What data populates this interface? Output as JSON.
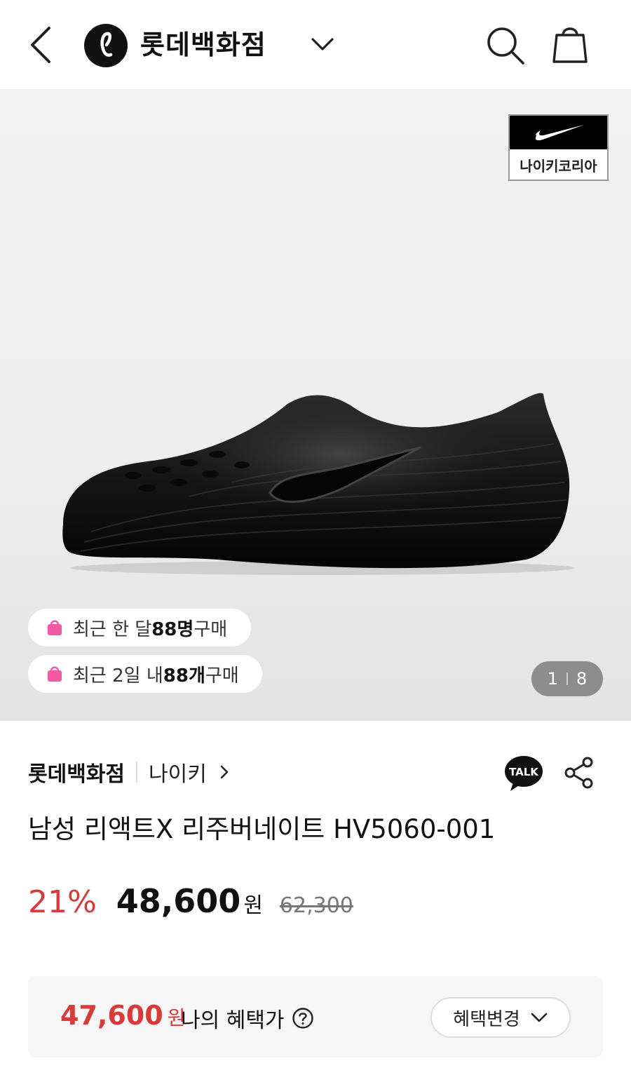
{
  "header": {
    "store_name": "롯데백화점",
    "logo_letter": "ℓ"
  },
  "hero": {
    "brand_badge_label": "나이키코리아",
    "chip1": {
      "prefix": "최근 한 달 ",
      "count": "88명",
      "suffix": " 구매"
    },
    "chip2": {
      "prefix": "최근 2일 내 ",
      "count": "88개",
      "suffix": " 구매"
    },
    "pager": {
      "current": "1",
      "total": "8"
    }
  },
  "product": {
    "seller": "롯데백화점",
    "brand": "나이키",
    "talk_label": "TALK",
    "title": "남성 리액트X 리주버네이트 HV5060-001",
    "discount": "21%",
    "price": "48,600",
    "currency": "원",
    "original_price": "62,300"
  },
  "benefit": {
    "price": "47,600",
    "currency": "원",
    "label": "나의 혜택가",
    "button_label": "혜택변경"
  },
  "colors": {
    "accent_red": "#d93a3a",
    "chip_bag_pink": "#f25aa3"
  },
  "icons": [
    "back-icon",
    "chevron-down-icon",
    "search-icon",
    "shopping-bag-icon",
    "nike-swoosh-icon",
    "talk-icon",
    "share-icon",
    "help-icon"
  ]
}
